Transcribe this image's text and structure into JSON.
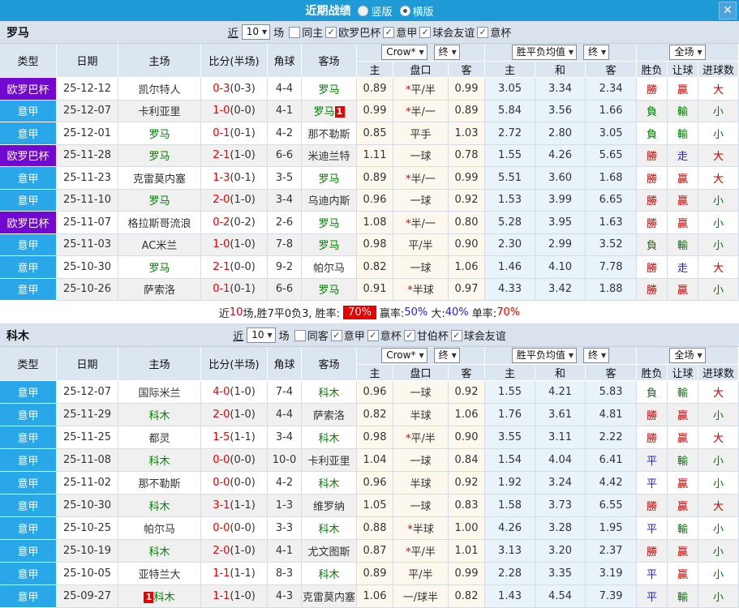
{
  "title_bar": {
    "title": "近期战绩",
    "radios": [
      {
        "label": "竖版",
        "checked": false
      },
      {
        "label": "横版",
        "checked": true
      }
    ],
    "close_icon": "✕"
  },
  "table_header": {
    "type": "类型",
    "date": "日期",
    "home": "主场",
    "score": "比分(半场)",
    "corner": "角球",
    "away": "客场",
    "odds_company": "Crow*",
    "odds_stage": "终",
    "mean_label": "胜平负均值",
    "mean_stage": "终",
    "scope": "全场",
    "sub": {
      "odds_home": "主",
      "handicap": "盘口",
      "odds_away": "客",
      "mean_home": "主",
      "mean_draw": "和",
      "mean_away": "客",
      "result": "胜负",
      "handicap_result": "让球",
      "goals": "进球数"
    }
  },
  "colors": {
    "titlebar_blue": "#1E9AD6",
    "league_purple": "#7209D0",
    "league_blue": "#2AA7E8",
    "win_red": "#CC0000",
    "lose_green": "#007A00",
    "draw_blue": "#2020CC",
    "score_red": "#E60000",
    "team_green": "#008000",
    "odds_bg": "#FDF8EE",
    "mean_bg": "#E8F4FA"
  },
  "sections": [
    {
      "team": "罗马",
      "filter": {
        "near": "近",
        "count": "10",
        "games": "场",
        "uncheck_label": "同主",
        "checked": [
          "欧罗巴杯",
          "意甲",
          "球会友谊",
          "意杯"
        ]
      },
      "rows": [
        {
          "league": "欧罗巴杯",
          "lc": "purple",
          "date": "25-12-12",
          "home": "凯尔特人",
          "hf": false,
          "away": "罗马",
          "af": true,
          "ft": "0-3",
          "ht": "0-3",
          "corner": "4-4",
          "odds": [
            "0.89",
            "*平/半",
            "0.99"
          ],
          "mean": [
            "3.05",
            "3.34",
            "2.34"
          ],
          "result": [
            "勝",
            "贏",
            "大"
          ]
        },
        {
          "league": "意甲",
          "lc": "blue",
          "date": "25-12-07",
          "home": "卡利亚里",
          "hf": false,
          "away": "罗马",
          "af": true,
          "ab": "1",
          "ft": "1-0",
          "ht": "0-0",
          "corner": "4-1",
          "odds": [
            "0.99",
            "*半/一",
            "0.89"
          ],
          "mean": [
            "5.84",
            "3.56",
            "1.66"
          ],
          "result": [
            "負",
            "輸",
            "小"
          ]
        },
        {
          "league": "意甲",
          "lc": "blue",
          "date": "25-12-01",
          "home": "罗马",
          "hf": true,
          "away": "那不勒斯",
          "af": false,
          "ft": "0-1",
          "ht": "0-1",
          "corner": "4-2",
          "odds": [
            "0.85",
            "平手",
            "1.03"
          ],
          "mean": [
            "2.72",
            "2.80",
            "3.05"
          ],
          "result": [
            "負",
            "輸",
            "小"
          ]
        },
        {
          "league": "欧罗巴杯",
          "lc": "purple",
          "date": "25-11-28",
          "home": "罗马",
          "hf": true,
          "away": "米迪兰特",
          "af": false,
          "ft": "2-1",
          "ht": "1-0",
          "corner": "6-6",
          "odds": [
            "1.11",
            "一球",
            "0.78"
          ],
          "mean": [
            "1.55",
            "4.26",
            "5.65"
          ],
          "result": [
            "勝",
            "走",
            "大"
          ]
        },
        {
          "league": "意甲",
          "lc": "blue",
          "date": "25-11-23",
          "home": "克雷莫内塞",
          "hf": false,
          "away": "罗马",
          "af": true,
          "ft": "1-3",
          "ht": "0-1",
          "corner": "3-5",
          "odds": [
            "0.89",
            "*半/一",
            "0.99"
          ],
          "mean": [
            "5.51",
            "3.60",
            "1.68"
          ],
          "result": [
            "勝",
            "贏",
            "大"
          ]
        },
        {
          "league": "意甲",
          "lc": "blue",
          "date": "25-11-10",
          "home": "罗马",
          "hf": true,
          "away": "乌迪内斯",
          "af": false,
          "ft": "2-0",
          "ht": "1-0",
          "corner": "3-4",
          "odds": [
            "0.96",
            "一球",
            "0.92"
          ],
          "mean": [
            "1.53",
            "3.99",
            "6.65"
          ],
          "result": [
            "勝",
            "贏",
            "小"
          ]
        },
        {
          "league": "欧罗巴杯",
          "lc": "purple",
          "date": "25-11-07",
          "home": "格拉斯哥流浪",
          "hf": false,
          "away": "罗马",
          "af": true,
          "ft": "0-2",
          "ht": "0-2",
          "corner": "2-6",
          "odds": [
            "1.08",
            "*半/一",
            "0.80"
          ],
          "mean": [
            "5.28",
            "3.95",
            "1.63"
          ],
          "result": [
            "勝",
            "贏",
            "小"
          ]
        },
        {
          "league": "意甲",
          "lc": "blue",
          "date": "25-11-03",
          "home": "AC米兰",
          "hf": false,
          "away": "罗马",
          "af": true,
          "ft": "1-0",
          "ht": "1-0",
          "corner": "7-8",
          "odds": [
            "0.98",
            "平/半",
            "0.90"
          ],
          "mean": [
            "2.30",
            "2.99",
            "3.52"
          ],
          "result": [
            "負",
            "輸",
            "小"
          ]
        },
        {
          "league": "意甲",
          "lc": "blue",
          "date": "25-10-30",
          "home": "罗马",
          "hf": true,
          "away": "帕尔马",
          "af": false,
          "ft": "2-1",
          "ht": "0-0",
          "corner": "9-2",
          "odds": [
            "0.82",
            "一球",
            "1.06"
          ],
          "mean": [
            "1.46",
            "4.10",
            "7.78"
          ],
          "result": [
            "勝",
            "走",
            "大"
          ]
        },
        {
          "league": "意甲",
          "lc": "blue",
          "date": "25-10-26",
          "home": "萨索洛",
          "hf": false,
          "away": "罗马",
          "af": true,
          "ft": "0-1",
          "ht": "0-1",
          "corner": "6-6",
          "odds": [
            "0.91",
            "*半球",
            "0.97"
          ],
          "mean": [
            "4.33",
            "3.42",
            "1.88"
          ],
          "result": [
            "勝",
            "贏",
            "小"
          ]
        }
      ],
      "summary": [
        {
          "t": "近",
          "s": "k"
        },
        {
          "t": "10",
          "s": "r"
        },
        {
          "t": "场,胜7平0负3, 胜率:",
          "s": "k"
        },
        {
          "t": "70%",
          "s": "box"
        },
        {
          "t": "赢率:",
          "s": "k"
        },
        {
          "t": "50%",
          "s": "b"
        },
        {
          "t": " 大:",
          "s": "k"
        },
        {
          "t": "40%",
          "s": "b"
        },
        {
          "t": " 单率:",
          "s": "k"
        },
        {
          "t": "70%",
          "s": "r"
        }
      ]
    },
    {
      "team": "科木",
      "filter": {
        "near": "近",
        "count": "10",
        "games": "场",
        "uncheck_label": "同客",
        "checked": [
          "意甲",
          "意杯",
          "甘伯杯",
          "球会友谊"
        ]
      },
      "rows": [
        {
          "league": "意甲",
          "lc": "blue",
          "date": "25-12-07",
          "home": "国际米兰",
          "hf": false,
          "away": "科木",
          "af": true,
          "ft": "4-0",
          "ht": "1-0",
          "corner": "7-4",
          "odds": [
            "0.96",
            "一球",
            "0.92"
          ],
          "mean": [
            "1.55",
            "4.21",
            "5.83"
          ],
          "result": [
            "負",
            "輸",
            "大"
          ]
        },
        {
          "league": "意甲",
          "lc": "blue",
          "date": "25-11-29",
          "home": "科木",
          "hf": true,
          "away": "萨索洛",
          "af": false,
          "ft": "2-0",
          "ht": "1-0",
          "corner": "4-4",
          "odds": [
            "0.82",
            "半球",
            "1.06"
          ],
          "mean": [
            "1.76",
            "3.61",
            "4.81"
          ],
          "result": [
            "勝",
            "贏",
            "小"
          ]
        },
        {
          "league": "意甲",
          "lc": "blue",
          "date": "25-11-25",
          "home": "都灵",
          "hf": false,
          "away": "科木",
          "af": true,
          "ft": "1-5",
          "ht": "1-1",
          "corner": "3-4",
          "odds": [
            "0.98",
            "*平/半",
            "0.90"
          ],
          "mean": [
            "3.55",
            "3.11",
            "2.22"
          ],
          "result": [
            "勝",
            "贏",
            "大"
          ]
        },
        {
          "league": "意甲",
          "lc": "blue",
          "date": "25-11-08",
          "home": "科木",
          "hf": true,
          "away": "卡利亚里",
          "af": false,
          "ft": "0-0",
          "ht": "0-0",
          "corner": "10-0",
          "odds": [
            "1.04",
            "一球",
            "0.84"
          ],
          "mean": [
            "1.54",
            "4.04",
            "6.41"
          ],
          "result": [
            "平",
            "輸",
            "小"
          ]
        },
        {
          "league": "意甲",
          "lc": "blue",
          "date": "25-11-02",
          "home": "那不勒斯",
          "hf": false,
          "away": "科木",
          "af": true,
          "ft": "0-0",
          "ht": "0-0",
          "corner": "4-2",
          "odds": [
            "0.96",
            "半球",
            "0.92"
          ],
          "mean": [
            "1.92",
            "3.24",
            "4.42"
          ],
          "result": [
            "平",
            "贏",
            "小"
          ]
        },
        {
          "league": "意甲",
          "lc": "blue",
          "date": "25-10-30",
          "home": "科木",
          "hf": true,
          "away": "维罗纳",
          "af": false,
          "ft": "3-1",
          "ht": "1-1",
          "corner": "1-3",
          "odds": [
            "1.05",
            "一球",
            "0.83"
          ],
          "mean": [
            "1.58",
            "3.73",
            "6.55"
          ],
          "result": [
            "勝",
            "贏",
            "大"
          ]
        },
        {
          "league": "意甲",
          "lc": "blue",
          "date": "25-10-25",
          "home": "帕尔马",
          "hf": false,
          "away": "科木",
          "af": true,
          "ft": "0-0",
          "ht": "0-0",
          "corner": "3-3",
          "odds": [
            "0.88",
            "*半球",
            "1.00"
          ],
          "mean": [
            "4.26",
            "3.28",
            "1.95"
          ],
          "result": [
            "平",
            "輸",
            "小"
          ]
        },
        {
          "league": "意甲",
          "lc": "blue",
          "date": "25-10-19",
          "home": "科木",
          "hf": true,
          "away": "尤文图斯",
          "af": false,
          "ft": "2-0",
          "ht": "1-0",
          "corner": "4-1",
          "odds": [
            "0.87",
            "*平/半",
            "1.01"
          ],
          "mean": [
            "3.13",
            "3.20",
            "2.37"
          ],
          "result": [
            "勝",
            "贏",
            "小"
          ]
        },
        {
          "league": "意甲",
          "lc": "blue",
          "date": "25-10-05",
          "home": "亚特兰大",
          "hf": false,
          "away": "科木",
          "af": true,
          "ft": "1-1",
          "ht": "1-1",
          "corner": "8-3",
          "odds": [
            "0.89",
            "平/半",
            "0.99"
          ],
          "mean": [
            "2.28",
            "3.35",
            "3.19"
          ],
          "result": [
            "平",
            "贏",
            "小"
          ]
        },
        {
          "league": "意甲",
          "lc": "blue",
          "date": "25-09-27",
          "home": "科木",
          "hf": true,
          "hb_pre": "1",
          "away": "克雷莫内塞",
          "af": false,
          "ft": "1-1",
          "ht": "1-0",
          "corner": "4-3",
          "odds": [
            "1.06",
            "一/球半",
            "0.82"
          ],
          "mean": [
            "1.43",
            "4.54",
            "7.39"
          ],
          "result": [
            "平",
            "輸",
            "小"
          ]
        }
      ]
    }
  ]
}
